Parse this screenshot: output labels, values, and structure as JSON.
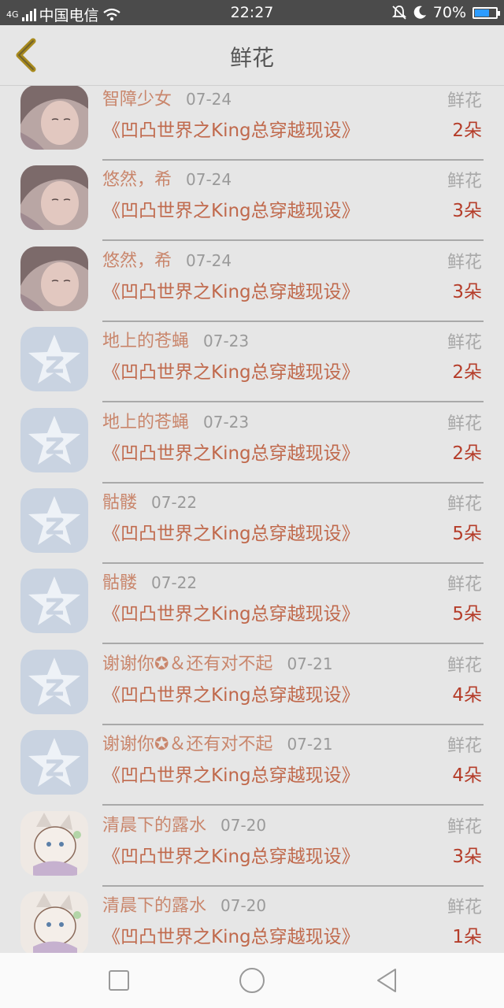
{
  "status": {
    "carrier": "中国电信",
    "network": "4G",
    "time": "22:27",
    "battery": "70%",
    "battery_level": 0.7
  },
  "header": {
    "title": "鲜花"
  },
  "items": [
    {
      "name": "智障少女",
      "date": "07-24",
      "type": "鲜花",
      "book": "《凹凸世界之King总穿越现设》",
      "count": "2朵",
      "avatar": "girl-photo"
    },
    {
      "name": "悠然，希",
      "date": "07-24",
      "type": "鲜花",
      "book": "《凹凸世界之King总穿越现设》",
      "count": "3朵",
      "avatar": "girl-photo"
    },
    {
      "name": "悠然，希",
      "date": "07-24",
      "type": "鲜花",
      "book": "《凹凸世界之King总穿越现设》",
      "count": "3朵",
      "avatar": "girl-photo"
    },
    {
      "name": "地上的苍蝇",
      "date": "07-23",
      "type": "鲜花",
      "book": "《凹凸世界之King总穿越现设》",
      "count": "2朵",
      "avatar": "qzone-star"
    },
    {
      "name": "地上的苍蝇",
      "date": "07-23",
      "type": "鲜花",
      "book": "《凹凸世界之King总穿越现设》",
      "count": "2朵",
      "avatar": "qzone-star"
    },
    {
      "name": "骷髅",
      "date": "07-22",
      "type": "鲜花",
      "book": "《凹凸世界之King总穿越现设》",
      "count": "5朵",
      "avatar": "qzone-star"
    },
    {
      "name": "骷髅",
      "date": "07-22",
      "type": "鲜花",
      "book": "《凹凸世界之King总穿越现设》",
      "count": "5朵",
      "avatar": "qzone-star"
    },
    {
      "name": "谢谢你✪＆还有对不起",
      "date": "07-21",
      "type": "鲜花",
      "book": "《凹凸世界之King总穿越现设》",
      "count": "4朵",
      "avatar": "qzone-star"
    },
    {
      "name": "谢谢你✪＆还有对不起",
      "date": "07-21",
      "type": "鲜花",
      "book": "《凹凸世界之King总穿越现设》",
      "count": "4朵",
      "avatar": "qzone-star"
    },
    {
      "name": "清晨下的露水",
      "date": "07-20",
      "type": "鲜花",
      "book": "《凹凸世界之King总穿越现设》",
      "count": "3朵",
      "avatar": "anime-drawing"
    },
    {
      "name": "清晨下的露水",
      "date": "07-20",
      "type": "鲜花",
      "book": "《凹凸世界之King总穿越现设》",
      "count": "1朵",
      "avatar": "anime-drawing"
    }
  ],
  "icons": {
    "back": "chevron-left-icon",
    "recent": "square-icon",
    "home": "circle-icon",
    "nav_back": "triangle-back-icon"
  },
  "colors": {
    "back_arrow": "#a88a1e",
    "name": "#c9866c",
    "book": "#c0694c",
    "count": "#b53d2a"
  }
}
